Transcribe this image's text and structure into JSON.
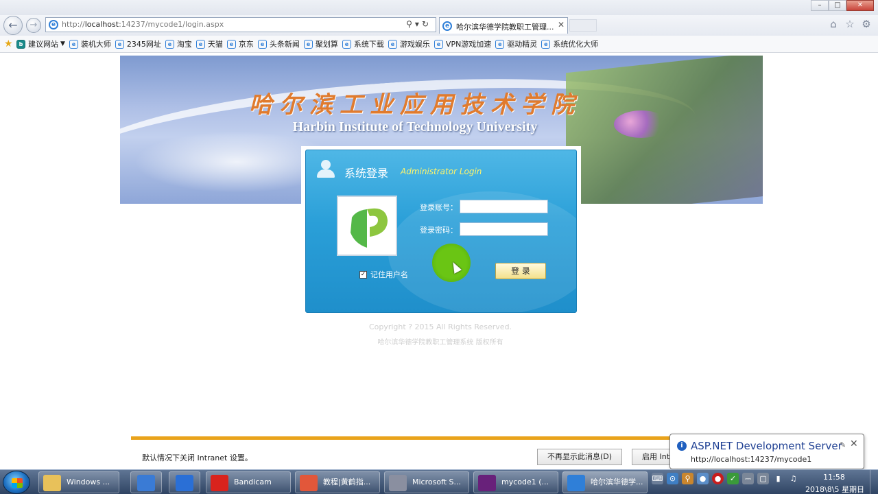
{
  "browser": {
    "address": {
      "host": "localhost",
      "rest": ":14237/mycode1/login.aspx",
      "prefix": "http://"
    },
    "tab_title": "哈尔滨华德学院教职工管理...",
    "favorites": [
      {
        "label": "建议网站",
        "has_caret": true
      },
      {
        "label": "装机大师"
      },
      {
        "label": "2345网址"
      },
      {
        "label": "淘宝"
      },
      {
        "label": "天猫"
      },
      {
        "label": "京东"
      },
      {
        "label": "头条新闻"
      },
      {
        "label": "聚划算"
      },
      {
        "label": "系统下载"
      },
      {
        "label": "游戏娱乐"
      },
      {
        "label": "VPN游戏加速"
      },
      {
        "label": "驱动精灵"
      },
      {
        "label": "系统优化大师"
      }
    ]
  },
  "banner": {
    "title_cn": "哈尔滨工业应用技术学院",
    "title_en": "Harbin Institute of Technology University"
  },
  "login": {
    "title": "系统登录",
    "subtitle": "Administrator Login",
    "account_label": "登录账号：",
    "password_label": "登录密码：",
    "account_value": "",
    "password_value": "",
    "remember_label": "记住用户名",
    "remember_checked": true,
    "submit_label": "登 录"
  },
  "footer": {
    "copyright": "Copyright ? 2015 All Rights Reserved.",
    "owner": "哈尔滨华德学院教职工管理系统 版权所有"
  },
  "notification": {
    "text": "默认情况下关闭 Intranet 设置。",
    "dont_show_label": "不再显示此消息(D)",
    "enable_label": "启用 Intranet 设置"
  },
  "balloon": {
    "title": "ASP.NET Development Server",
    "url": "http://localhost:14237/mycode1"
  },
  "taskbar": {
    "items": [
      {
        "label": "Windows ...",
        "color": "#e8c15a"
      },
      {
        "label": "",
        "color": "#3a7bd5"
      },
      {
        "label": "",
        "color": "#2a6fd6"
      },
      {
        "label": "Bandicam",
        "color": "#d9231d"
      },
      {
        "label": "教程|黄鹤指...",
        "color": "#e2573a"
      },
      {
        "label": "Microsoft S...",
        "color": "#8a8fa0"
      },
      {
        "label": "mycode1 (...",
        "color": "#68217a"
      },
      {
        "label": "哈尔滨华德学...",
        "color": "#2f7fd8"
      }
    ],
    "time": "11:58",
    "date": "2018\\8\\5 星期日"
  },
  "colors": {
    "login_panel": "#2a9fd8",
    "notify_accent": "#e9a31b",
    "cursor_highlight": "#6cc70a"
  }
}
